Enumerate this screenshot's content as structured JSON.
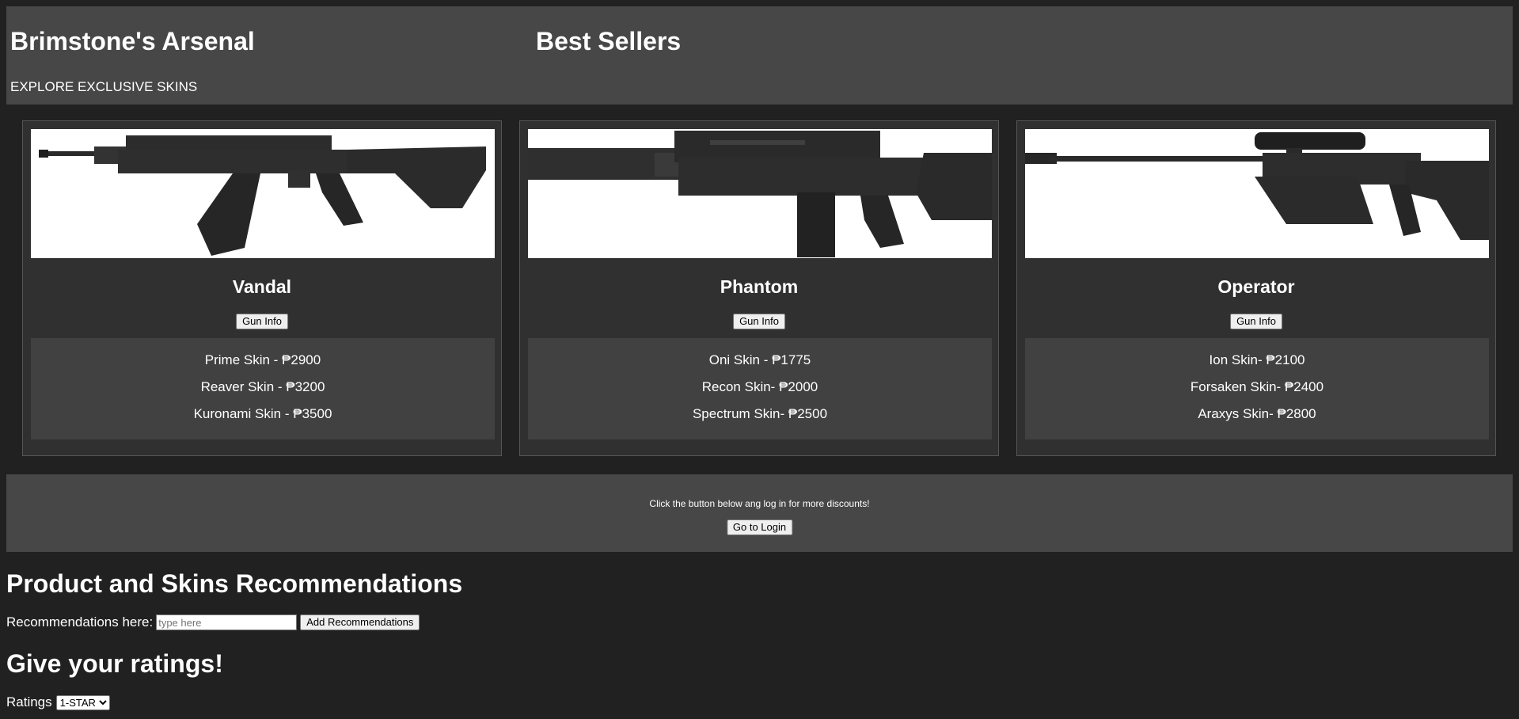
{
  "header": {
    "brand": "Brimstone's Arsenal",
    "tagline": "EXPLORE EXCLUSIVE SKINS",
    "section_title": "Best Sellers"
  },
  "cards": [
    {
      "name": "Vandal",
      "button": "Gun Info",
      "skins": [
        "Prime Skin - ₱2900",
        "Reaver Skin - ₱3200",
        "Kuronami Skin - ₱3500"
      ]
    },
    {
      "name": "Phantom",
      "button": "Gun Info",
      "skins": [
        "Oni Skin - ₱1775",
        "Recon Skin- ₱2000",
        "Spectrum Skin- ₱2500"
      ]
    },
    {
      "name": "Operator",
      "button": "Gun Info",
      "skins": [
        "Ion Skin- ₱2100",
        "Forsaken Skin- ₱2400",
        "Araxys Skin- ₱2800"
      ]
    }
  ],
  "promo": {
    "text": "Click the button below ang log in for more discounts!",
    "button": "Go to Login"
  },
  "recommendations": {
    "title": "Product and Skins Recommendations",
    "label": "Recommendations here:",
    "placeholder": "type here",
    "button": "Add Recommendations"
  },
  "ratings": {
    "title": "Give your ratings!",
    "label": "Ratings",
    "selected": "1-STAR"
  },
  "colors": {
    "page_bg": "#212121",
    "panel_bg": "#474747",
    "card_bg": "#303030",
    "skins_bg": "#414141"
  },
  "icons": [
    "vandal-rifle-image",
    "phantom-rifle-image",
    "operator-sniper-image"
  ]
}
